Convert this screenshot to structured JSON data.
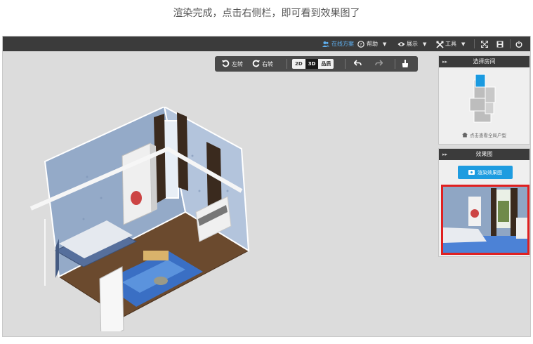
{
  "caption": "渲染完成，点击右侧栏，即可看到效果图了",
  "topbar": {
    "online_plan": "在线方案",
    "help": "帮助",
    "display": "展示",
    "tools": "工具"
  },
  "toolbar": {
    "rotate_left": "左转",
    "rotate_right": "右转",
    "mode_2d": "2D",
    "mode_3d": "3D",
    "mode_vr": "品质"
  },
  "rooms_panel": {
    "title": "选择房间",
    "view_full_plan": "点击查看全局户型"
  },
  "render_panel": {
    "title": "效果图",
    "render_button": "渲染效果图"
  },
  "colors": {
    "topbar": "#3b3b3b",
    "accent_blue": "#1e9ce0",
    "highlight_red": "#e02020",
    "workspace": "#dcdcdc"
  }
}
